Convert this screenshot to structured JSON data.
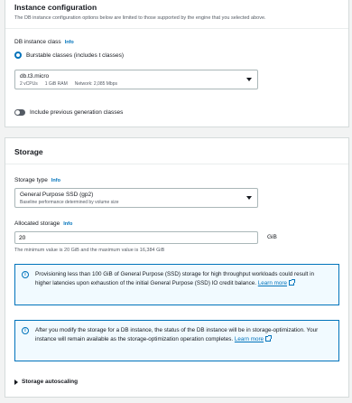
{
  "instance_config": {
    "title": "Instance configuration",
    "description": "The DB instance configuration options below are limited to those supported by the engine that you selected above.",
    "class_label": "DB instance class",
    "info": "Info",
    "radio_label": "Burstable classes (includes t classes)",
    "select": {
      "value": "db.t3.micro",
      "vcpus": "2 vCPUs",
      "ram": "1 GiB RAM",
      "network": "Network: 2,085 Mbps"
    },
    "toggle_label": "Include previous generation classes"
  },
  "storage": {
    "title": "Storage",
    "type_label": "Storage type",
    "info": "Info",
    "type_select": {
      "value": "General Purpose SSD (gp2)",
      "sub": "Baseline performance determined by volume size"
    },
    "allocated_label": "Allocated storage",
    "allocated_value": "20",
    "unit": "GiB",
    "constraint": "The minimum value is 20 GiB and the maximum value is 16,384 GiB",
    "alert1_text": "Provisioning less than 100 GiB of General Purpose (SSD) storage for high throughput workloads could result in higher latencies upon exhaustion of the initial General Purpose (SSD) IO credit balance.",
    "alert2_text": "After you modify the storage for a DB instance, the status of the DB instance will be in storage-optimization. Your instance will remain available as the storage-optimization operation completes.",
    "learn_more": "Learn more",
    "autoscaling_label": "Storage autoscaling"
  }
}
